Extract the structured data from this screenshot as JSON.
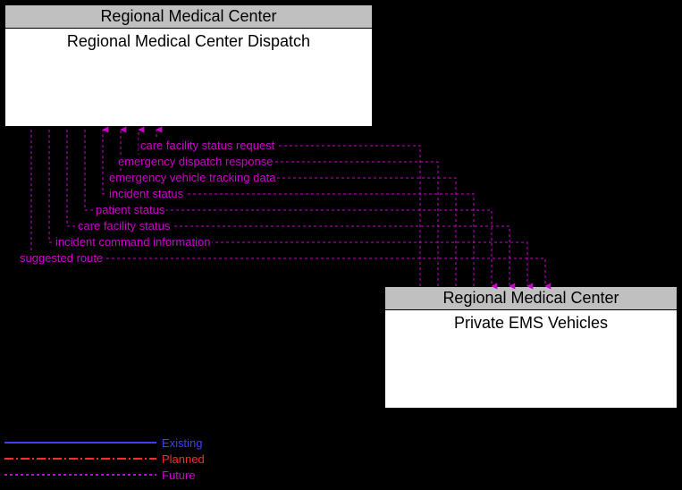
{
  "nodes": {
    "dispatch": {
      "header": "Regional Medical Center",
      "title": "Regional Medical Center Dispatch"
    },
    "ems": {
      "header": "Regional Medical Center",
      "title": "Private EMS Vehicles"
    }
  },
  "flows": [
    {
      "label": "care facility status request"
    },
    {
      "label": "emergency dispatch response"
    },
    {
      "label": "emergency vehicle tracking data"
    },
    {
      "label": "incident status"
    },
    {
      "label": "patient status"
    },
    {
      "label": "care facility status"
    },
    {
      "label": "incident command information"
    },
    {
      "label": "suggested route"
    }
  ],
  "legend": {
    "existing": "Existing",
    "planned": "Planned",
    "future": "Future"
  }
}
